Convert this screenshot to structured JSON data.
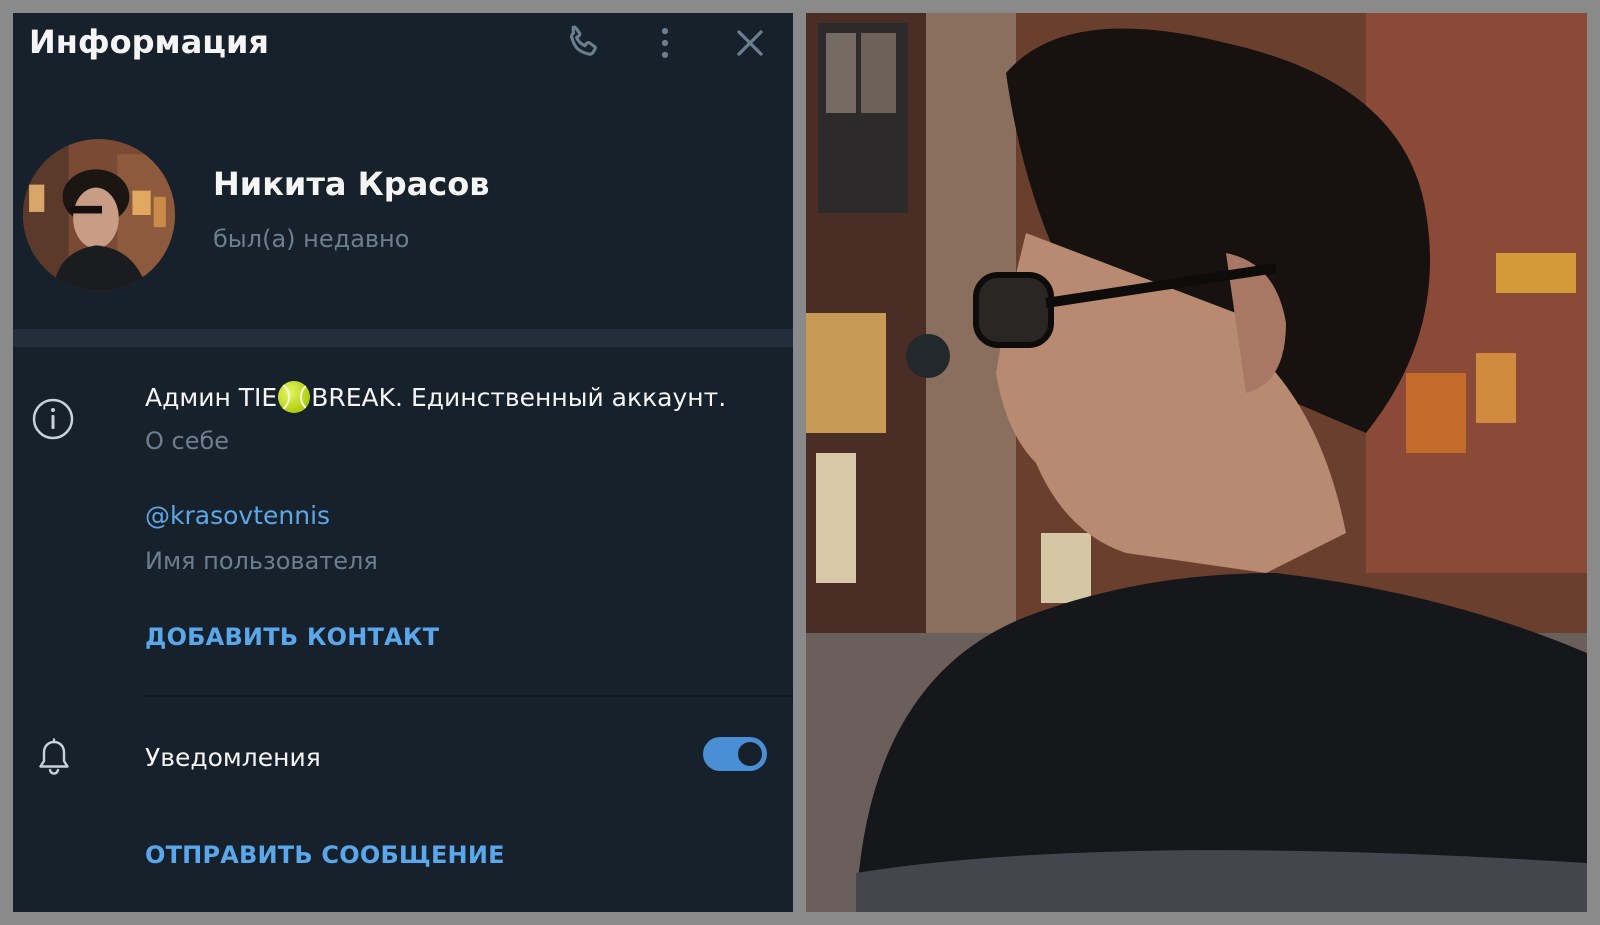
{
  "header": {
    "title": "Информация",
    "call_icon": "phone-icon",
    "menu_icon": "more-vertical-icon",
    "close_icon": "close-icon"
  },
  "profile": {
    "name": "Никита Красов",
    "status": "был(а) недавно"
  },
  "about": {
    "icon": "info-icon",
    "text_before": "Админ TIE",
    "emoji": "tennis-ball-icon",
    "text_after": "BREAK. Единственный аккаунт.",
    "label": "О себе"
  },
  "username": {
    "value": "@krasovtennis",
    "label": "Имя пользователя"
  },
  "actions": {
    "add_contact": "ДОБАВИТЬ КОНТАКТ",
    "send_message": "ОТПРАВИТЬ СООБЩЕНИЕ"
  },
  "notifications": {
    "icon": "bell-icon",
    "label": "Уведомления",
    "enabled": true
  },
  "colors": {
    "panel_bg": "#17212b",
    "accent": "#5aa7eb",
    "muted_text": "#6d7f8f",
    "primary_text": "#f5f5f5"
  }
}
